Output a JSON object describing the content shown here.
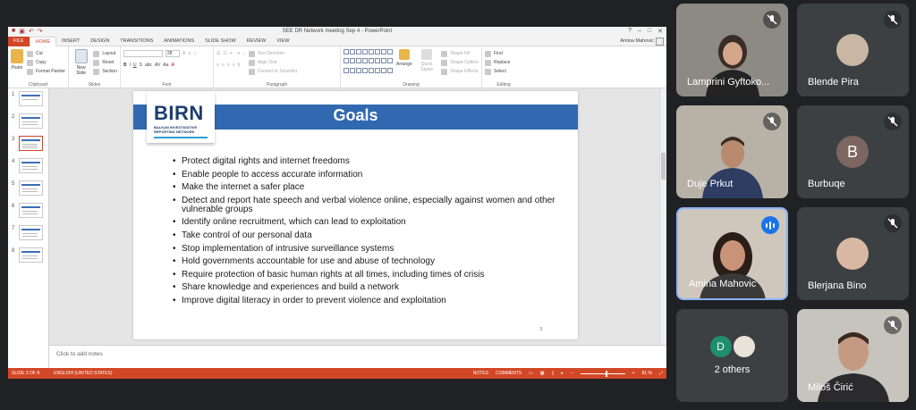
{
  "app": {
    "window_title": "SEE DR Network meeting Sep 4 - PowerPoint",
    "user": "Amina Mahovic",
    "tabs": [
      "FILE",
      "HOME",
      "INSERT",
      "DESIGN",
      "TRANSITIONS",
      "ANIMATIONS",
      "SLIDE SHOW",
      "REVIEW",
      "VIEW"
    ]
  },
  "ribbon": {
    "clipboard": {
      "label": "Clipboard",
      "paste": "Paste",
      "cut": "Cut",
      "copy": "Copy",
      "format_painter": "Format Painter"
    },
    "slides": {
      "label": "Slides",
      "new_slide": "New Slide",
      "layout": "Layout",
      "reset": "Reset",
      "section": "Section"
    },
    "font": {
      "label": "Font",
      "size": "28"
    },
    "paragraph": {
      "label": "Paragraph",
      "text_direction": "Text Direction",
      "align_text": "Align Text",
      "convert": "Convert to SmartArt"
    },
    "drawing": {
      "label": "Drawing",
      "arrange": "Arrange",
      "quick_styles": "Quick Styles",
      "shape_fill": "Shape Fill",
      "shape_outline": "Shape Outline",
      "shape_effects": "Shape Effects"
    },
    "editing": {
      "label": "Editing",
      "find": "Find",
      "replace": "Replace",
      "select": "Select"
    }
  },
  "thumbnails": [
    "1",
    "2",
    "3",
    "4",
    "5",
    "6",
    "7",
    "8"
  ],
  "selected_slide": 3,
  "slide": {
    "title": "Goals",
    "logo_text": "BIRN",
    "logo_tagline_1": "BALKAN INVESTIGATIVE",
    "logo_tagline_2": "REPORTING NETWORK",
    "bullets": [
      "Protect digital rights and internet freedoms",
      "Enable people to access accurate information",
      "Make the internet a safer place",
      "Detect and report hate speech and verbal violence online, especially against women and other vulnerable groups",
      "Identify online recruitment, which can lead to exploitation",
      "Take control of our personal data",
      "Stop implementation of intrusive surveillance systems",
      "Hold governments accountable for use and abuse of technology",
      "Require protection of basic human rights at all times, including times of crisis",
      "Share knowledge and experiences and build a network",
      "Improve digital literacy in order to prevent violence and exploitation"
    ],
    "number": "3"
  },
  "notes_placeholder": "Click to add notes",
  "statusbar": {
    "slide_of": "SLIDE 3 OF 8",
    "language": "ENGLISH (UNITED STATES)",
    "notes": "NOTES",
    "comments": "COMMENTS",
    "zoom": "81 %"
  },
  "participants": [
    {
      "name": "Lamprini Gyftoko...",
      "muted": true,
      "video": true
    },
    {
      "name": "Blende Pira",
      "muted": true,
      "video": false
    },
    {
      "name": "Duje Prkut",
      "muted": true,
      "video": true
    },
    {
      "name": "Burbuqe",
      "muted": true,
      "video": false,
      "initial": "B"
    },
    {
      "name": "Amina Mahovic",
      "muted": false,
      "speaking": true,
      "video": true
    },
    {
      "name": "Blerjana Bino",
      "muted": true,
      "video": false
    },
    {
      "name": "2 others",
      "initial": "D"
    },
    {
      "name": "Miloš Čirić",
      "muted": true,
      "video": true
    }
  ]
}
